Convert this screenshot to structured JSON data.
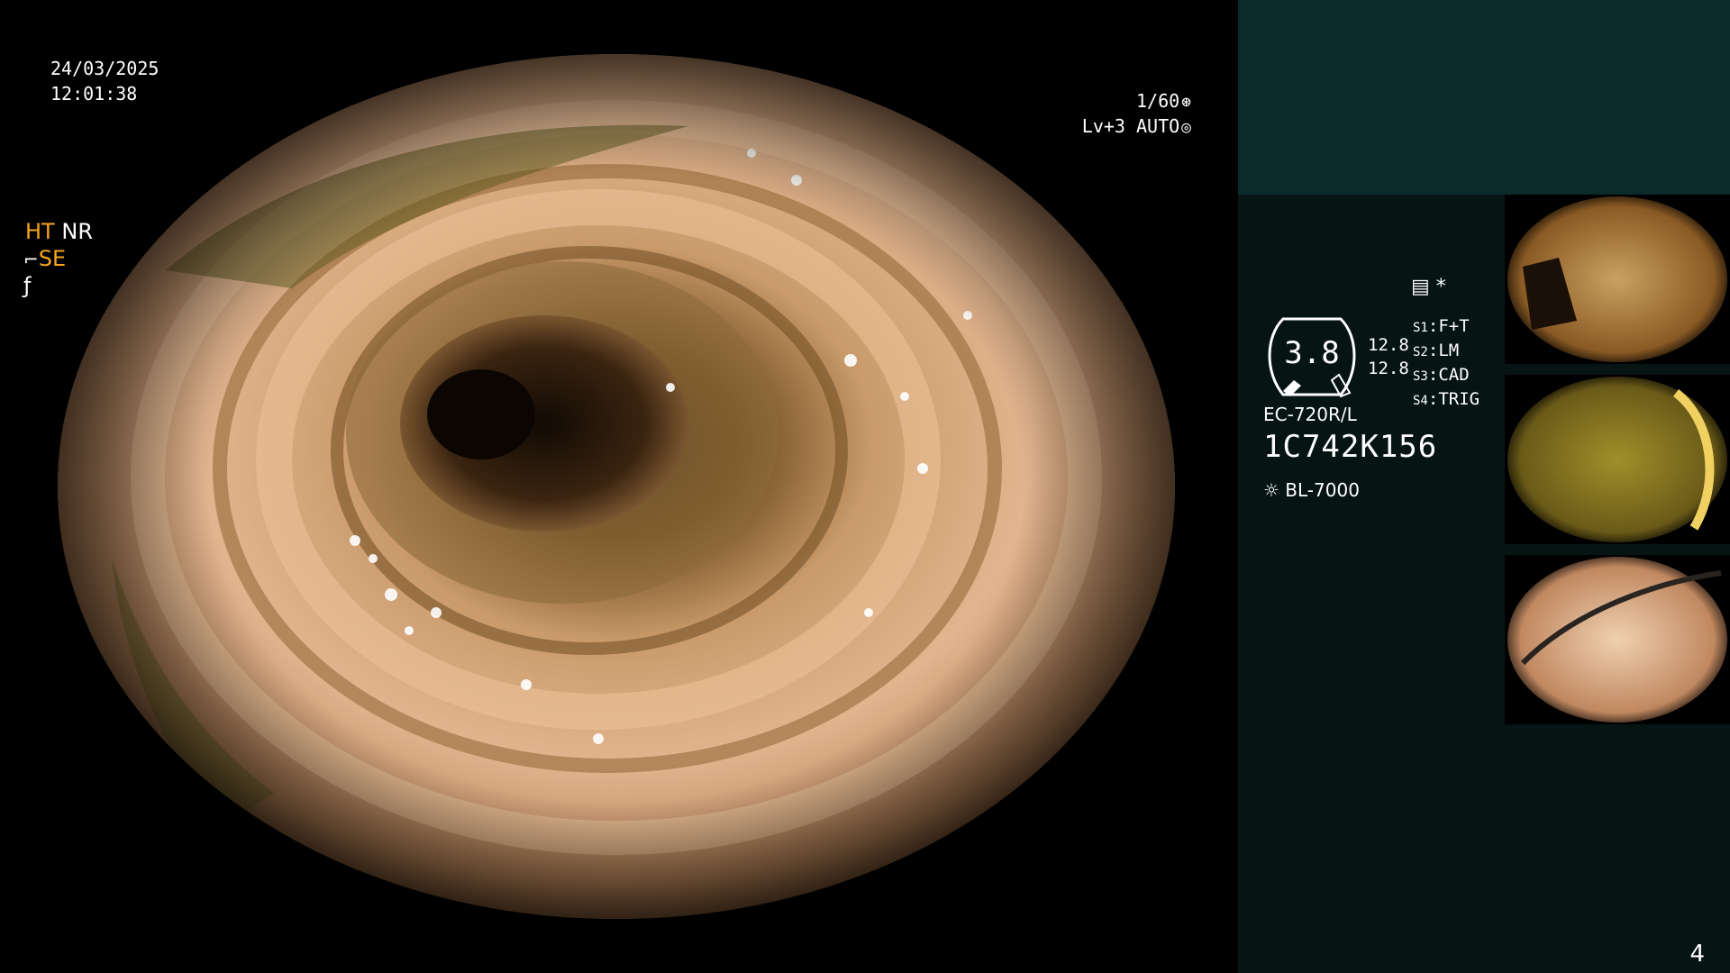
{
  "overlay": {
    "date": "24/03/2025",
    "time": "12:01:38",
    "shutter": "1/60",
    "auto_level": "Lv+3 AUTO"
  },
  "panel": {
    "ht": "HT",
    "nr": "NR",
    "se": "SE",
    "scale_value": "3.8",
    "pressure_1": "12.8",
    "pressure_2": "12.8",
    "switches": [
      {
        "key": "S1",
        "value": "F+T"
      },
      {
        "key": "S2",
        "value": "LM"
      },
      {
        "key": "S3",
        "value": "CAD"
      },
      {
        "key": "S4",
        "value": "TRIG"
      }
    ],
    "scope_model": "EC-720R/L",
    "serial": "1C742K156",
    "light_source": "BL-7000",
    "page_number": "4"
  },
  "colors": {
    "accent_orange": "#f6a51e",
    "panel_bg": "#061514",
    "panel_top_bg": "#0b2a2b"
  },
  "icons": {
    "shutter": "aperture-icon",
    "auto": "target-icon",
    "scope": "endoscope-icon",
    "freeze": "freeze-icon",
    "memory": "memory-card-icon",
    "light": "lamp-icon"
  }
}
